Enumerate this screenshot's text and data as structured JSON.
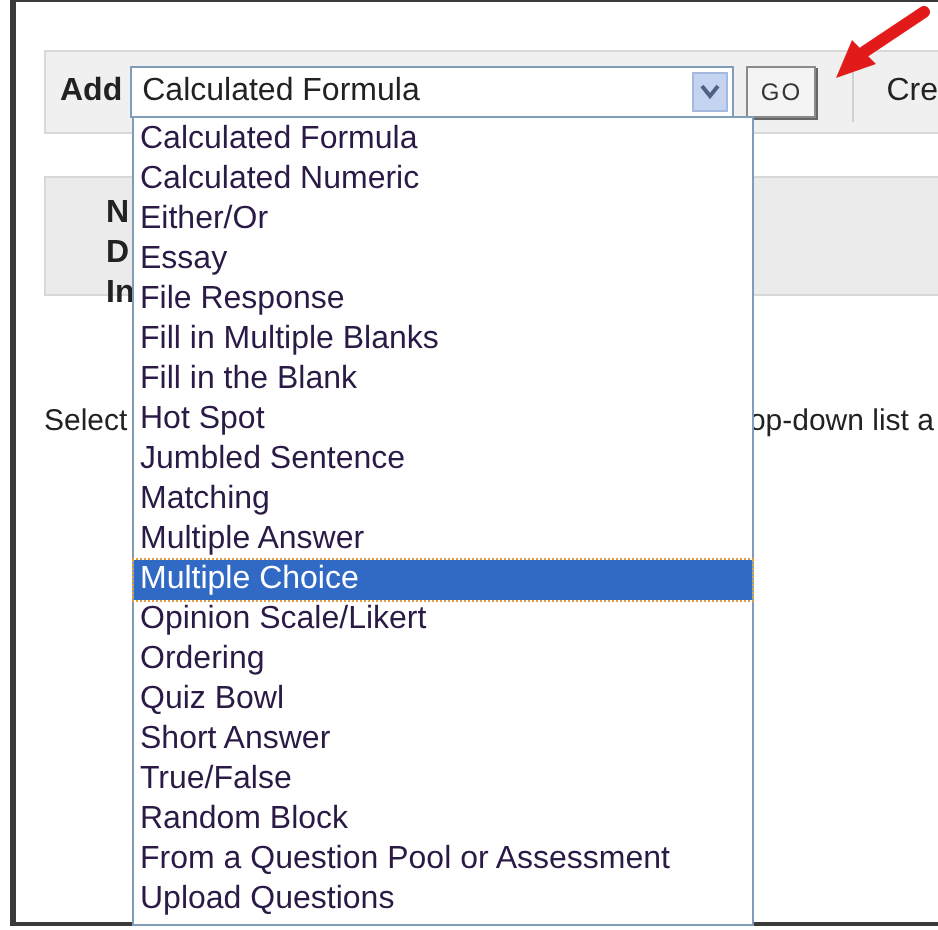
{
  "toolbar": {
    "label": "Add",
    "select": {
      "value": "Calculated Formula",
      "expanded": true
    },
    "go_button": "GO",
    "next_link": "Cre"
  },
  "info_panel": {
    "labels": [
      "N",
      "D",
      "In"
    ]
  },
  "instruction": {
    "left": "Select",
    "right": "op-down list a"
  },
  "options": [
    {
      "label": "Calculated Formula",
      "selected": false
    },
    {
      "label": "Calculated Numeric",
      "selected": false
    },
    {
      "label": "Either/Or",
      "selected": false
    },
    {
      "label": "Essay",
      "selected": false
    },
    {
      "label": "File Response",
      "selected": false
    },
    {
      "label": "Fill in Multiple Blanks",
      "selected": false
    },
    {
      "label": "Fill in the Blank",
      "selected": false
    },
    {
      "label": "Hot Spot",
      "selected": false
    },
    {
      "label": "Jumbled Sentence",
      "selected": false
    },
    {
      "label": "Matching",
      "selected": false
    },
    {
      "label": "Multiple Answer",
      "selected": false
    },
    {
      "label": "Multiple Choice",
      "selected": true
    },
    {
      "label": "Opinion Scale/Likert",
      "selected": false
    },
    {
      "label": "Ordering",
      "selected": false
    },
    {
      "label": "Quiz Bowl",
      "selected": false
    },
    {
      "label": "Short Answer",
      "selected": false
    },
    {
      "label": "True/False",
      "selected": false
    },
    {
      "label": "Random Block",
      "selected": false
    },
    {
      "label": "From a Question Pool or Assessment",
      "selected": false
    },
    {
      "label": "Upload Questions",
      "selected": false
    }
  ]
}
